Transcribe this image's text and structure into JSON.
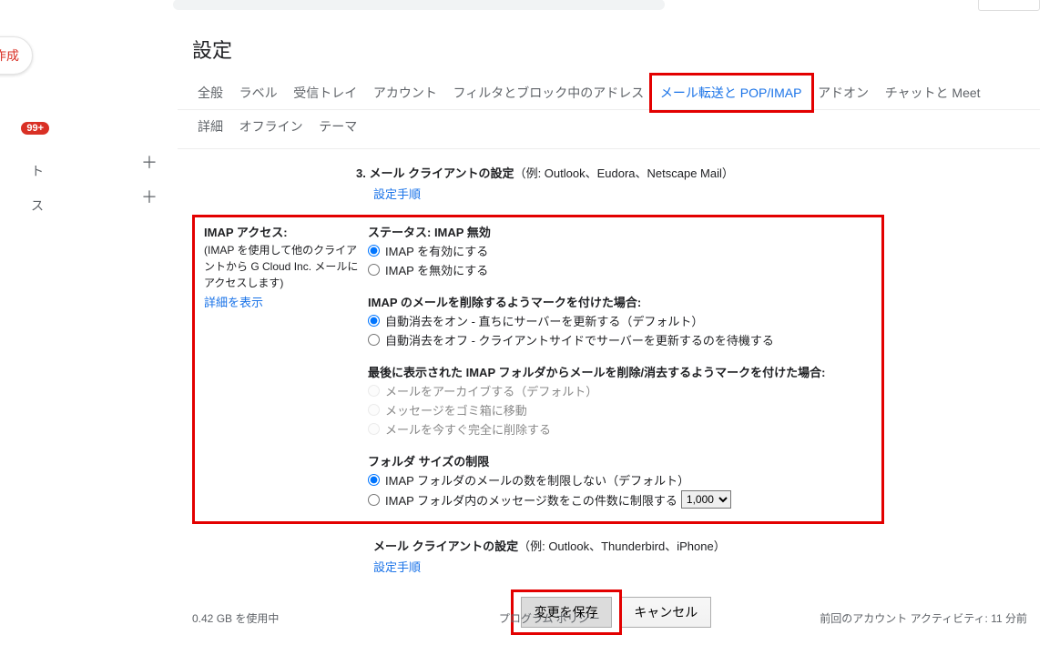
{
  "compose": "作成",
  "sidebar": {
    "badge": "99+",
    "item2_suffix": "ト",
    "item3_suffix": "ス"
  },
  "page_title": "設定",
  "tabs_row1": [
    {
      "label": "全般"
    },
    {
      "label": "ラベル"
    },
    {
      "label": "受信トレイ"
    },
    {
      "label": "アカウント"
    },
    {
      "label": "フィルタとブロック中のアドレス"
    },
    {
      "label": "メール転送と POP/IMAP",
      "active": true
    },
    {
      "label": "アドオン"
    },
    {
      "label": "チャットと Meet"
    }
  ],
  "tabs_row2": [
    {
      "label": "詳細"
    },
    {
      "label": "オフライン"
    },
    {
      "label": "テーマ"
    }
  ],
  "section3": {
    "num": "3.",
    "title": "メール クライアントの設定",
    "examples": "（例: Outlook、Eudora、Netscape Mail）",
    "steps_link": "設定手順"
  },
  "imap": {
    "left_title": "IMAP アクセス:",
    "left_desc": "(IMAP を使用して他のクライアントから G Cloud Inc. メールにアクセスします)",
    "detail_link": "詳細を表示",
    "status_label": "ステータス: IMAP 無効",
    "enable_opt": "IMAP を有効にする",
    "disable_opt": "IMAP を無効にする",
    "expunge_title": "IMAP のメールを削除するようマークを付けた場合:",
    "expunge_on": "自動消去をオン - 直ちにサーバーを更新する（デフォルト）",
    "expunge_off": "自動消去をオフ - クライアントサイドでサーバーを更新するのを待機する",
    "last_folder_title": "最後に表示された IMAP フォルダからメールを削除/消去するようマークを付けた場合:",
    "archive": "メールをアーカイブする（デフォルト）",
    "trash": "メッセージをゴミ箱に移動",
    "delete_now": "メールを今すぐ完全に削除する",
    "folder_size_title": "フォルダ サイズの制限",
    "no_limit": "IMAP フォルダのメールの数を制限しない（デフォルト）",
    "limit_to": "IMAP フォルダ内のメッセージ数をこの件数に制限する",
    "limit_options": [
      "1,000"
    ]
  },
  "after_box": {
    "title": "メール クライアントの設定",
    "examples": "（例: Outlook、Thunderbird、iPhone）",
    "steps_link": "設定手順"
  },
  "buttons": {
    "save": "変更を保存",
    "cancel": "キャンセル"
  },
  "footer": {
    "left": "0.42 GB を使用中",
    "center": "プログラム ポリシー",
    "right": "前回のアカウント アクティビティ: 11 分前"
  }
}
